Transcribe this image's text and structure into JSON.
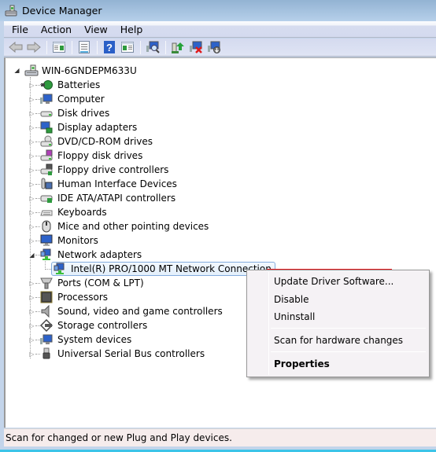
{
  "window": {
    "title": "Device Manager",
    "app_icon": "device-manager-icon"
  },
  "menubar": {
    "items": [
      "File",
      "Action",
      "View",
      "Help"
    ]
  },
  "toolbar": {
    "buttons": [
      {
        "name": "back-button",
        "icon": "arrow-left-icon"
      },
      {
        "name": "forward-button",
        "icon": "arrow-right-icon"
      },
      {
        "name": "show-hide-console-tree-button",
        "icon": "console-tree-icon"
      },
      {
        "name": "properties-button",
        "icon": "properties-sheet-icon"
      },
      {
        "name": "help-button",
        "icon": "help-icon"
      },
      {
        "name": "show-hide-action-pane-button",
        "icon": "action-pane-icon"
      },
      {
        "name": "scan-hardware-button",
        "icon": "scan-hardware-icon"
      },
      {
        "name": "update-driver-button",
        "icon": "update-driver-icon"
      },
      {
        "name": "uninstall-button",
        "icon": "uninstall-icon"
      },
      {
        "name": "disable-button",
        "icon": "disable-device-icon"
      }
    ]
  },
  "tree": {
    "root": {
      "label": "WIN-6GNDEPM633U",
      "expanded": true,
      "icon": "computer-root-icon"
    },
    "categories": [
      {
        "label": "Batteries",
        "icon": "battery-icon",
        "expanded": false
      },
      {
        "label": "Computer",
        "icon": "computer-icon",
        "expanded": false
      },
      {
        "label": "Disk drives",
        "icon": "disk-drive-icon",
        "expanded": false
      },
      {
        "label": "Display adapters",
        "icon": "display-adapter-icon",
        "expanded": false
      },
      {
        "label": "DVD/CD-ROM drives",
        "icon": "dvd-drive-icon",
        "expanded": false
      },
      {
        "label": "Floppy disk drives",
        "icon": "floppy-disk-icon",
        "expanded": false
      },
      {
        "label": "Floppy drive controllers",
        "icon": "floppy-controller-icon",
        "expanded": false
      },
      {
        "label": "Human Interface Devices",
        "icon": "hid-icon",
        "expanded": false
      },
      {
        "label": "IDE ATA/ATAPI controllers",
        "icon": "ide-controller-icon",
        "expanded": false
      },
      {
        "label": "Keyboards",
        "icon": "keyboard-icon",
        "expanded": false
      },
      {
        "label": "Mice and other pointing devices",
        "icon": "mouse-icon",
        "expanded": false
      },
      {
        "label": "Monitors",
        "icon": "monitor-icon",
        "expanded": false
      },
      {
        "label": "Network adapters",
        "icon": "network-adapter-icon",
        "expanded": true,
        "children": [
          {
            "label": "Intel(R) PRO/1000 MT Network Connection",
            "icon": "network-adapter-icon",
            "selected": true
          }
        ]
      },
      {
        "label": "Ports (COM & LPT)",
        "icon": "port-icon",
        "expanded": false
      },
      {
        "label": "Processors",
        "icon": "processor-icon",
        "expanded": false
      },
      {
        "label": "Sound, video and game controllers",
        "icon": "speaker-icon",
        "expanded": false
      },
      {
        "label": "Storage controllers",
        "icon": "storage-controller-icon",
        "expanded": false
      },
      {
        "label": "System devices",
        "icon": "system-devices-icon",
        "expanded": false
      },
      {
        "label": "Universal Serial Bus controllers",
        "icon": "usb-icon",
        "expanded": false
      }
    ]
  },
  "context_menu": {
    "items": [
      {
        "label": "Update Driver Software...",
        "bold": false,
        "highlighted": true
      },
      {
        "label": "Disable",
        "bold": false
      },
      {
        "label": "Uninstall",
        "bold": false
      },
      {
        "separator": true
      },
      {
        "label": "Scan for hardware changes",
        "bold": false
      },
      {
        "separator": true
      },
      {
        "label": "Properties",
        "bold": true
      }
    ],
    "highlight_color": "#e8141b"
  },
  "statusbar": {
    "text": "Scan for changed or new Plug and Play devices."
  }
}
